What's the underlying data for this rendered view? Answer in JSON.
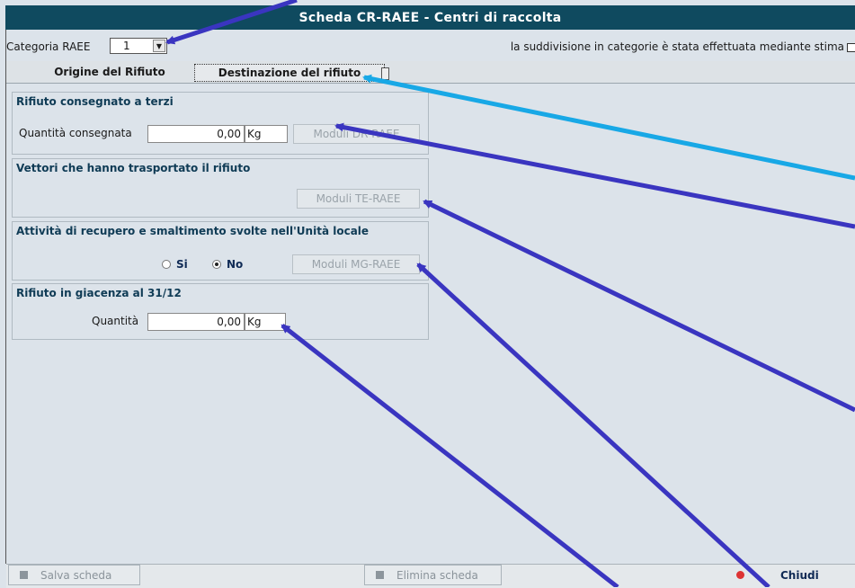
{
  "window": {
    "title": "Scheda CR-RAEE - Centri di raccolta"
  },
  "category": {
    "label": "Categoria RAEE",
    "value": "1",
    "estimate_text": "la suddivisione in categorie è stata effettuata mediante stima"
  },
  "tabs": {
    "origin": "Origine del Rifiuto",
    "destination": "Destinazione del rifiuto"
  },
  "panels": {
    "delivered": {
      "title": "Rifiuto consegnato a terzi",
      "qty_label": "Quantità consegnata",
      "qty_value": "0,00",
      "unit": "Kg",
      "button": "Moduli DR-RAEE"
    },
    "carriers": {
      "title": "Vettori che hanno trasportato il rifiuto",
      "button": "Moduli TE-RAEE"
    },
    "recovery": {
      "title": "Attività di recupero e smaltimento svolte nell'Unità locale",
      "yes": "Si",
      "no": "No",
      "selected": "No",
      "button": "Moduli MG-RAEE"
    },
    "stock": {
      "title": "Rifiuto in giacenza al 31/12",
      "qty_label": "Quantità",
      "qty_value": "0,00",
      "unit": "Kg"
    }
  },
  "footer": {
    "save": "Salva scheda",
    "delete": "Elimina scheda",
    "close": "Chiudi"
  },
  "colors": {
    "title_bg": "#0f4a5f",
    "arrow_dark": "#3a35c0",
    "arrow_light": "#18a8e6"
  }
}
